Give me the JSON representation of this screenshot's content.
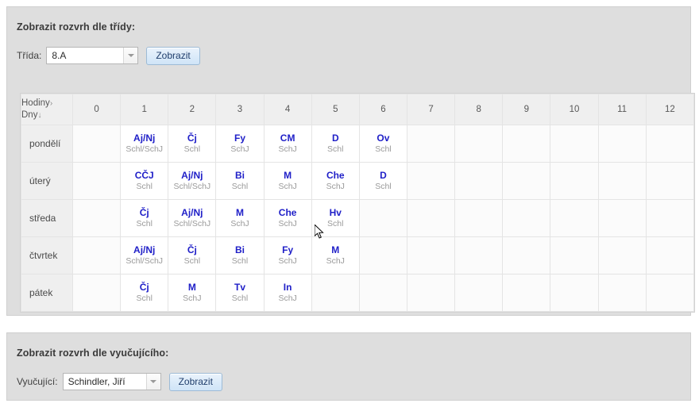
{
  "class_panel": {
    "title": "Zobrazit rozvrh dle třídy:",
    "field_label": "Třída:",
    "selected_class": "8.A",
    "submit_label": "Zobrazit"
  },
  "teacher_panel": {
    "title": "Zobrazit rozvrh dle vyučujícího:",
    "field_label": "Vyučující:",
    "selected_teacher": "Schindler, Jiří",
    "submit_label": "Zobrazit"
  },
  "timetable": {
    "corner_line1": "Hodiny",
    "corner_line1_arrow": "›",
    "corner_line2": "Dny",
    "corner_line2_arrow": "↓",
    "periods": [
      "0",
      "1",
      "2",
      "3",
      "4",
      "5",
      "6",
      "7",
      "8",
      "9",
      "10",
      "11",
      "12"
    ],
    "rows": [
      {
        "day": "pondělí",
        "cells": [
          {
            "subject": "",
            "room": ""
          },
          {
            "subject": "Aj/Nj",
            "room": "Schl/SchJ"
          },
          {
            "subject": "Čj",
            "room": "Schl"
          },
          {
            "subject": "Fy",
            "room": "SchJ"
          },
          {
            "subject": "CM",
            "room": "SchJ"
          },
          {
            "subject": "D",
            "room": "Schl"
          },
          {
            "subject": "Ov",
            "room": "Schl"
          },
          {
            "subject": "",
            "room": ""
          },
          {
            "subject": "",
            "room": ""
          },
          {
            "subject": "",
            "room": ""
          },
          {
            "subject": "",
            "room": ""
          },
          {
            "subject": "",
            "room": ""
          },
          {
            "subject": "",
            "room": ""
          }
        ]
      },
      {
        "day": "úterý",
        "cells": [
          {
            "subject": "",
            "room": ""
          },
          {
            "subject": "CČJ",
            "room": "Schl"
          },
          {
            "subject": "Aj/Nj",
            "room": "Schl/SchJ"
          },
          {
            "subject": "Bi",
            "room": "Schl"
          },
          {
            "subject": "M",
            "room": "SchJ"
          },
          {
            "subject": "Che",
            "room": "SchJ"
          },
          {
            "subject": "D",
            "room": "Schl"
          },
          {
            "subject": "",
            "room": ""
          },
          {
            "subject": "",
            "room": ""
          },
          {
            "subject": "",
            "room": ""
          },
          {
            "subject": "",
            "room": ""
          },
          {
            "subject": "",
            "room": ""
          },
          {
            "subject": "",
            "room": ""
          }
        ]
      },
      {
        "day": "středa",
        "cells": [
          {
            "subject": "",
            "room": ""
          },
          {
            "subject": "Čj",
            "room": "Schl"
          },
          {
            "subject": "Aj/Nj",
            "room": "Schl/SchJ"
          },
          {
            "subject": "M",
            "room": "SchJ"
          },
          {
            "subject": "Che",
            "room": "SchJ"
          },
          {
            "subject": "Hv",
            "room": "Schl"
          },
          {
            "subject": "",
            "room": ""
          },
          {
            "subject": "",
            "room": ""
          },
          {
            "subject": "",
            "room": ""
          },
          {
            "subject": "",
            "room": ""
          },
          {
            "subject": "",
            "room": ""
          },
          {
            "subject": "",
            "room": ""
          },
          {
            "subject": "",
            "room": ""
          }
        ]
      },
      {
        "day": "čtvrtek",
        "cells": [
          {
            "subject": "",
            "room": ""
          },
          {
            "subject": "Aj/Nj",
            "room": "Schl/SchJ"
          },
          {
            "subject": "Čj",
            "room": "Schl"
          },
          {
            "subject": "Bi",
            "room": "Schl"
          },
          {
            "subject": "Fy",
            "room": "SchJ"
          },
          {
            "subject": "M",
            "room": "SchJ"
          },
          {
            "subject": "",
            "room": ""
          },
          {
            "subject": "",
            "room": ""
          },
          {
            "subject": "",
            "room": ""
          },
          {
            "subject": "",
            "room": ""
          },
          {
            "subject": "",
            "room": ""
          },
          {
            "subject": "",
            "room": ""
          },
          {
            "subject": "",
            "room": ""
          }
        ]
      },
      {
        "day": "pátek",
        "cells": [
          {
            "subject": "",
            "room": ""
          },
          {
            "subject": "Čj",
            "room": "Schl"
          },
          {
            "subject": "M",
            "room": "SchJ"
          },
          {
            "subject": "Tv",
            "room": "Schl"
          },
          {
            "subject": "In",
            "room": "SchJ"
          },
          {
            "subject": "",
            "room": ""
          },
          {
            "subject": "",
            "room": ""
          },
          {
            "subject": "",
            "room": ""
          },
          {
            "subject": "",
            "room": ""
          },
          {
            "subject": "",
            "room": ""
          },
          {
            "subject": "",
            "room": ""
          },
          {
            "subject": "",
            "room": ""
          },
          {
            "subject": "",
            "room": ""
          }
        ]
      }
    ]
  },
  "colors": {
    "subject": "#2020c8",
    "room": "#9a9a9a",
    "panel_bg": "#dedede",
    "header_bg": "#efefef"
  }
}
